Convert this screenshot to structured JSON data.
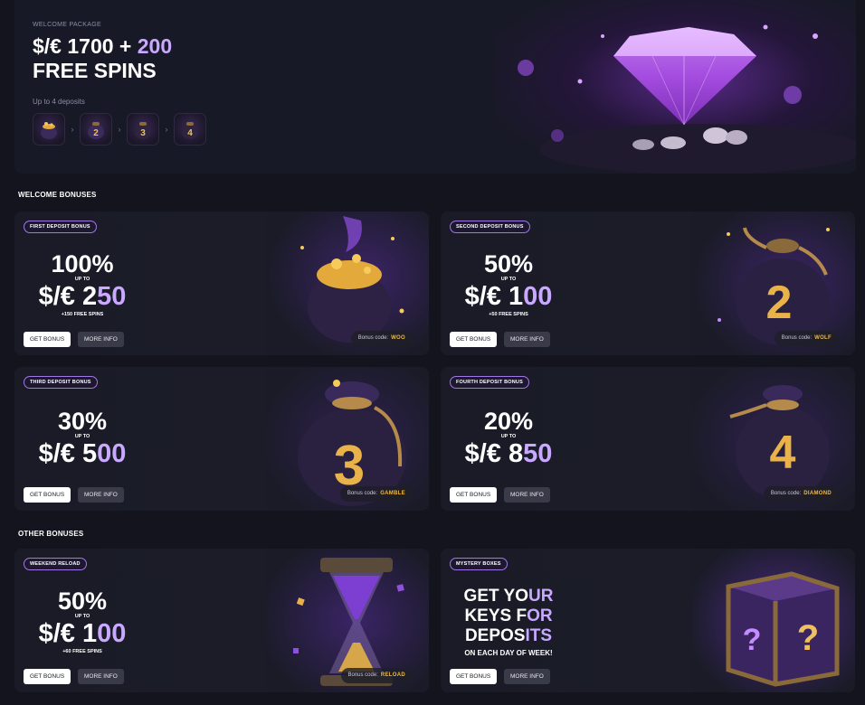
{
  "hero": {
    "eyebrow": "WELCOME PACKAGE",
    "title_main": "$/€ 1700 + ",
    "title_accent": "200",
    "title_line2": "FREE SPINS",
    "deposits_note": "Up to 4 deposits",
    "step_arrow": "›",
    "steps": [
      "bag-1-icon",
      "bag-2-icon",
      "bag-3-icon",
      "bag-4-icon"
    ]
  },
  "sections": {
    "welcome": "WELCOME BONUSES",
    "other": "OTHER BONUSES"
  },
  "buttons": {
    "get_bonus": "GET BONUS",
    "more_info": "MORE INFO",
    "code_prefix": "Bonus code:"
  },
  "cards": {
    "first": {
      "badge": "FIRST DEPOSIT BONUS",
      "pct": "100%",
      "upto": "UP TO",
      "amt_main": "$/€ 2",
      "amt_accent": "50",
      "spins": "+150 FREE SPINS",
      "code": "WOO"
    },
    "second": {
      "badge": "SECOND DEPOSIT BONUS",
      "pct": "50%",
      "upto": "UP TO",
      "amt_main": "$/€ 1",
      "amt_accent": "00",
      "spins": "+50 FREE SPINS",
      "code": "WOLF"
    },
    "third": {
      "badge": "THIRD DEPOSIT BONUS",
      "pct": "30%",
      "upto": "UP TO",
      "amt_main": "$/€ 5",
      "amt_accent": "00",
      "code": "GAMBLE"
    },
    "fourth": {
      "badge": "FOURTH DEPOSIT BONUS",
      "pct": "20%",
      "upto": "UP TO",
      "amt_main": "$/€ 8",
      "amt_accent": "50",
      "code": "DIAMOND"
    },
    "weekend": {
      "badge": "WEEKEND RELOAD",
      "pct": "50%",
      "upto": "UP TO",
      "amt_main": "$/€ 1",
      "amt_accent": "00",
      "spins": "+60 FREE SPINS",
      "code": "RELOAD"
    },
    "mystery": {
      "badge": "MYSTERY BOXES",
      "line1_main": "GET YO",
      "line1_accent": "UR",
      "line2_main": "KEYS F",
      "line2_accent": "OR",
      "line3_main": "DEPOS",
      "line3_accent": "ITS",
      "note": "ON EACH DAY OF WEEK!"
    }
  },
  "colors": {
    "background": "#13141e",
    "card": "#1a1b27",
    "accent_purple": "#c9a8ff",
    "badge_border": "#a078e6",
    "code_gold": "#f2b93a"
  }
}
